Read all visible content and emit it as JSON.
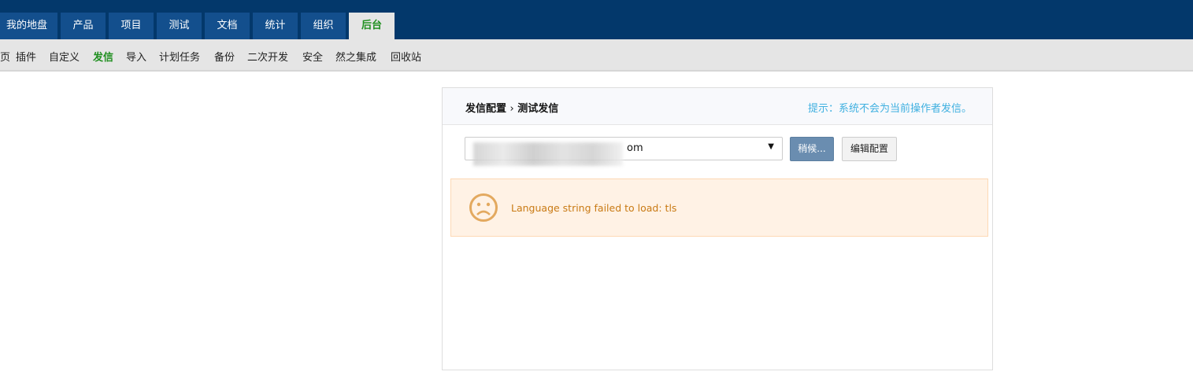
{
  "nav": {
    "tabs": [
      {
        "label": "我的地盘"
      },
      {
        "label": "产品"
      },
      {
        "label": "项目"
      },
      {
        "label": "测试"
      },
      {
        "label": "文档"
      },
      {
        "label": "统计"
      },
      {
        "label": "组织"
      },
      {
        "label": "后台",
        "active": true
      }
    ]
  },
  "subnav": {
    "items": [
      "首页",
      "插件",
      "自定义",
      "发信",
      "导入",
      "计划任务",
      "备份",
      "二次开发",
      "安全",
      "然之集成",
      "回收站"
    ],
    "active": "发信"
  },
  "panel": {
    "crumb_parent": "发信配置",
    "crumb_sep": "›",
    "crumb_current": "测试发信",
    "hint": "提示：系统不会为当前操作者发信。",
    "select_value": "om",
    "wait_button": "稍候...",
    "edit_button": "编辑配置",
    "alert_message": "Language string failed to load: tls",
    "alert_icon": "sad-face-icon"
  },
  "colors": {
    "nav": "#03386b",
    "tab": "#134f8d",
    "active_green": "#1f8f1f",
    "hint": "#3fb0e0",
    "alert_bg": "#fff2e5",
    "alert_text": "#c97a14"
  }
}
